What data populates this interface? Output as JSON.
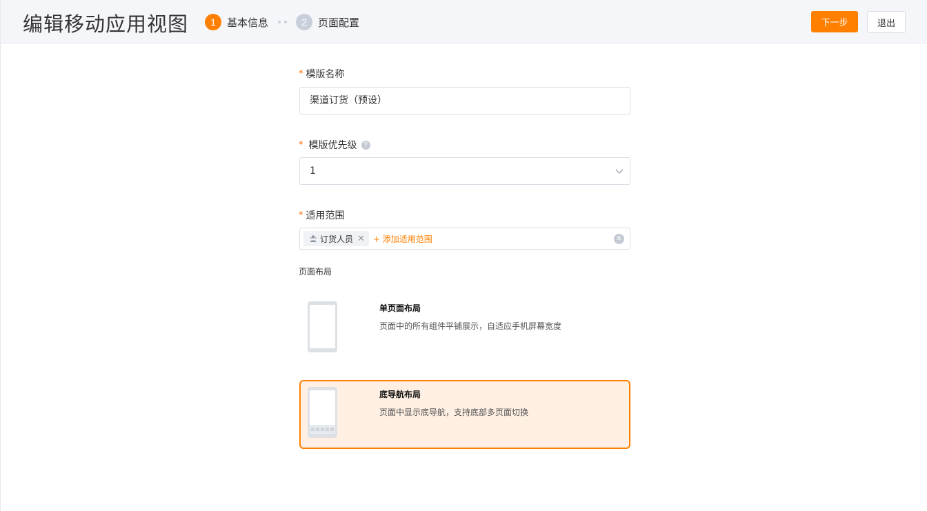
{
  "header": {
    "title": "编辑移动应用视图",
    "steps": [
      {
        "num": "1",
        "label": "基本信息",
        "state": "active"
      },
      {
        "num": "2",
        "label": "页面配置",
        "state": "inactive"
      }
    ],
    "next_label": "下一步",
    "exit_label": "退出"
  },
  "form": {
    "template_name": {
      "required_mark": "*",
      "label": "模版名称",
      "value": "渠道订货（预设）"
    },
    "priority": {
      "required_mark": "*",
      "label": "模版优先级",
      "help_icon": "?",
      "value": "1"
    },
    "scope": {
      "required_mark": "*",
      "label": "适用范围",
      "tags": [
        {
          "label": "订货人员",
          "icon": "user-group-icon"
        }
      ],
      "add_label": "+ 添加适用范围"
    },
    "layout": {
      "label": "页面布局",
      "options": [
        {
          "title": "单页面布局",
          "desc": "页面中的所有组件平铺展示，自适应手机屏幕宽度",
          "selected": false
        },
        {
          "title": "底导航布局",
          "desc": "页面中显示底导航，支持底部多页面切换",
          "selected": true
        }
      ]
    }
  },
  "colors": {
    "accent": "#ff8000",
    "selected_bg": "#fff0e3",
    "border": "#d9dde3",
    "header_bg": "#f5f6f9"
  }
}
